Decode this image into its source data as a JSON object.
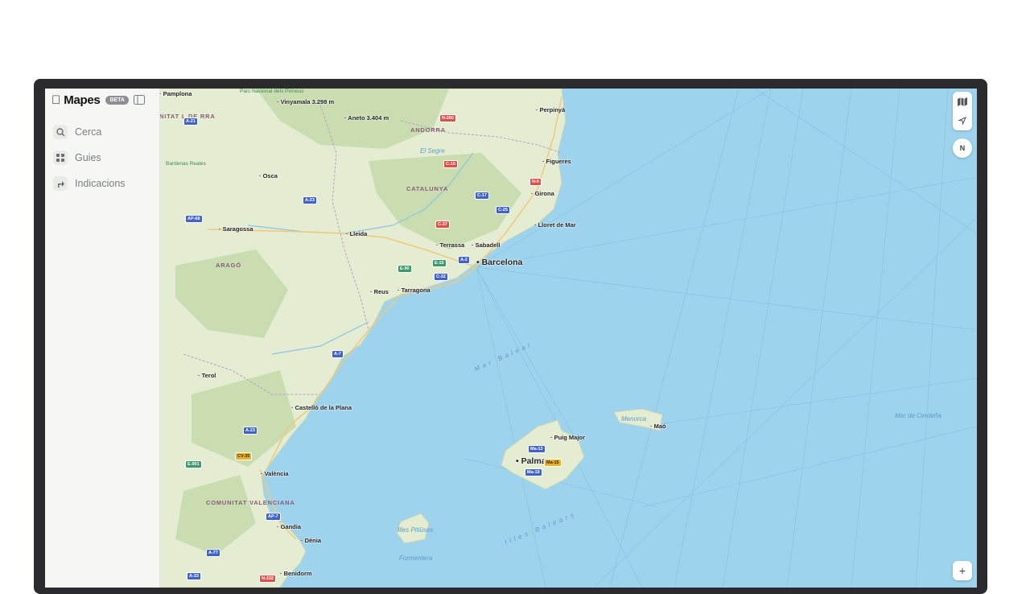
{
  "app": {
    "name": "Mapes",
    "badge": "BETA"
  },
  "sidebar": {
    "items": [
      {
        "label": "Cerca",
        "icon": "search-icon"
      },
      {
        "label": "Guies",
        "icon": "guides-icon"
      },
      {
        "label": "Indicacions",
        "icon": "directions-icon"
      }
    ]
  },
  "map": {
    "cities": [
      {
        "name": "Pamplona"
      },
      {
        "name": "Perpinyà"
      },
      {
        "name": "Figueres"
      },
      {
        "name": "Girona"
      },
      {
        "name": "Osca"
      },
      {
        "name": "Saragossa"
      },
      {
        "name": "Lleida"
      },
      {
        "name": "Lloret de Mar"
      },
      {
        "name": "Terrassa"
      },
      {
        "name": "Sabadell"
      },
      {
        "name": "Barcelona"
      },
      {
        "name": "Reus"
      },
      {
        "name": "Tarragona"
      },
      {
        "name": "Terol"
      },
      {
        "name": "Castelló de la Plana"
      },
      {
        "name": "València"
      },
      {
        "name": "Gandia"
      },
      {
        "name": "Dénia"
      },
      {
        "name": "Benidorm"
      },
      {
        "name": "Palma"
      },
      {
        "name": "Maó"
      },
      {
        "name": "Puig Major"
      },
      {
        "name": "Aneto 3.404 m"
      },
      {
        "name": "Vinyamala 3.298 m"
      }
    ],
    "regions": [
      {
        "name": "CATALUNYA"
      },
      {
        "name": "ARAGÓ"
      },
      {
        "name": "ANDORRA"
      },
      {
        "name": "COMUNITAT VALENCIANA"
      },
      {
        "name": "NITAT L DE RRA"
      }
    ],
    "water": [
      {
        "name": "Mar Balear"
      },
      {
        "name": "Illes Balears"
      },
      {
        "name": "Mar de Cerdeña"
      },
      {
        "name": "Menorca"
      },
      {
        "name": "Illes Pitiüses"
      },
      {
        "name": "Formentera"
      },
      {
        "name": "El Segre"
      }
    ],
    "parks": [
      {
        "name": "Parc Nacional dels Pirineus"
      },
      {
        "name": "Bardenas Reales"
      }
    ],
    "roads": [
      {
        "label": "A-21",
        "kind": "blue"
      },
      {
        "label": "N-260",
        "kind": "red"
      },
      {
        "label": "C-16",
        "kind": "red"
      },
      {
        "label": "N-II",
        "kind": "red"
      },
      {
        "label": "C-17",
        "kind": "blue"
      },
      {
        "label": "C-25",
        "kind": "blue"
      },
      {
        "label": "A-23",
        "kind": "blue"
      },
      {
        "label": "AP-68",
        "kind": "blue"
      },
      {
        "label": "C-37",
        "kind": "red"
      },
      {
        "label": "E-90",
        "kind": "green"
      },
      {
        "label": "E-15",
        "kind": "green"
      },
      {
        "label": "A-2",
        "kind": "blue"
      },
      {
        "label": "C-32",
        "kind": "blue"
      },
      {
        "label": "A-7",
        "kind": "blue"
      },
      {
        "label": "A-23",
        "kind": "blue"
      },
      {
        "label": "CV-35",
        "kind": "yellow"
      },
      {
        "label": "E-901",
        "kind": "green"
      },
      {
        "label": "AP-7",
        "kind": "blue"
      },
      {
        "label": "A-77",
        "kind": "blue"
      },
      {
        "label": "A-33",
        "kind": "blue"
      },
      {
        "label": "N-332",
        "kind": "red"
      },
      {
        "label": "Ma-13",
        "kind": "blue"
      },
      {
        "label": "Ma-15",
        "kind": "yellow"
      },
      {
        "label": "Ma-19",
        "kind": "blue"
      }
    ]
  },
  "controls": {
    "compass": "N",
    "zoom_in": "+"
  },
  "colors": {
    "sea": "#9ed3ee",
    "land": "#e4ecd2",
    "forest": "#c9ddb0",
    "blue_shield": "#3f63c9",
    "red_shield": "#e0504a",
    "green_shield": "#3d9a6d",
    "yellow_shield": "#e9b22a"
  }
}
